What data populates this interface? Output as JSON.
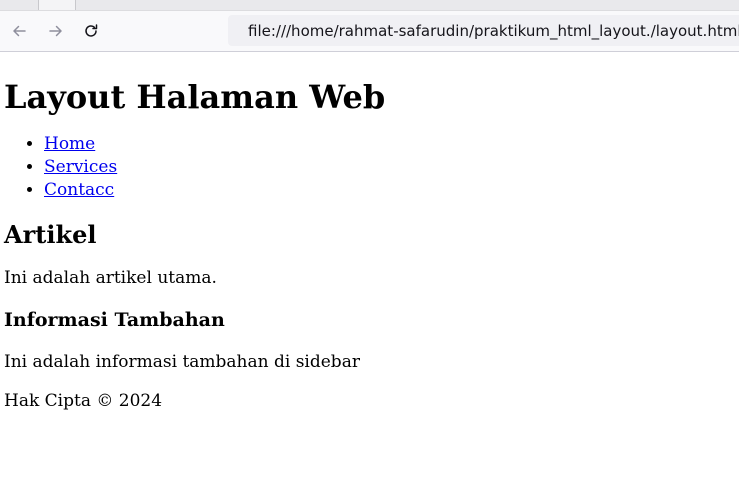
{
  "browser": {
    "url": "file:///home/rahmat-safarudin/praktikum_html_layout./layout.html",
    "icons": {
      "back": "arrow-left-icon",
      "forward": "arrow-right-icon",
      "reload": "reload-icon",
      "page": "page-icon"
    }
  },
  "header": {
    "title": "Layout Halaman Web"
  },
  "nav": {
    "items": [
      {
        "label": "Home"
      },
      {
        "label": "Services"
      },
      {
        "label": "Contacc"
      }
    ]
  },
  "article": {
    "heading": "Artikel",
    "text": "Ini adalah artikel utama."
  },
  "sidebar": {
    "heading": "Informasi Tambahan",
    "text": "Ini adalah informasi tambahan di sidebar"
  },
  "footer": {
    "text": "Hak Cipta © 2024"
  },
  "colors": {
    "link": "#0000ee",
    "toolbar_bg": "#f9f9fb",
    "urlbar_bg": "#f0f0f4"
  }
}
